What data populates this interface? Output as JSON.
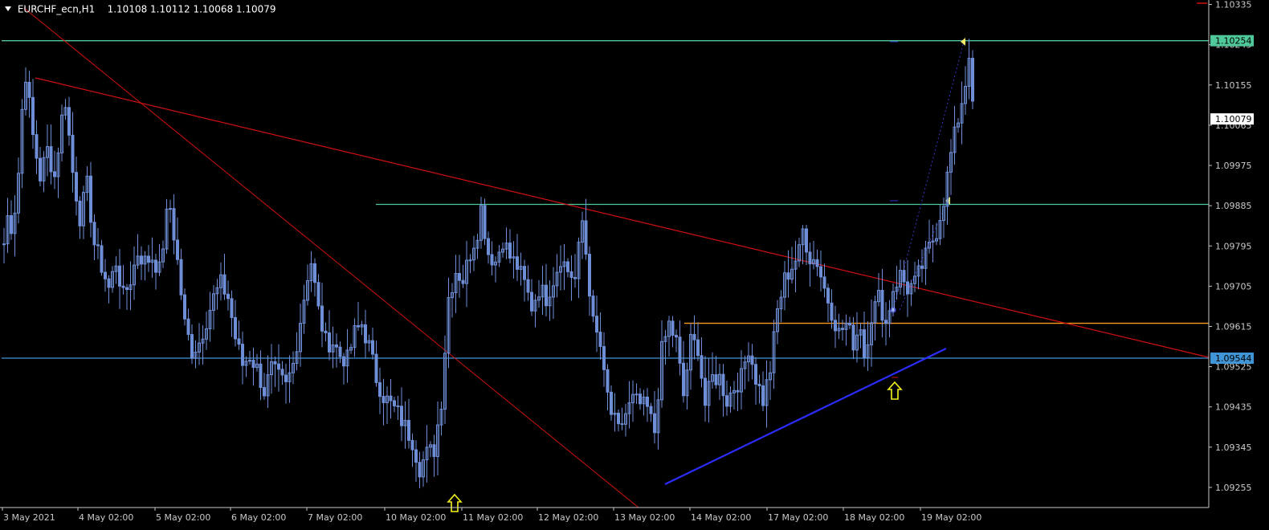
{
  "header": {
    "symbol": "EURCHF_ecn,H1",
    "ohlc": "1.10108 1.10112 1.10068 1.10079"
  },
  "colors": {
    "background": "#000000",
    "candle": "#6e8fd8",
    "axis": "#c8c8c8",
    "trend_red": "#d01010",
    "resistance_green": "#4fc99a",
    "support_orange": "#ff9a1a",
    "support_blue": "#3f95d6",
    "trend_blue": "#2c2cff",
    "arrow_yellow": "#f2f21e",
    "current_price_bg": "#ffffff"
  },
  "chart_data": {
    "type": "candlestick",
    "y_ticks": [
      "1.10335",
      "1.10245",
      "1.10155",
      "1.10065",
      "1.09975",
      "1.09885",
      "1.09795",
      "1.09705",
      "1.09615",
      "1.09525",
      "1.09435",
      "1.09345",
      "1.09255"
    ],
    "x_ticks": [
      "3 May 2021",
      "4 May 02:00",
      "5 May 02:00",
      "6 May 02:00",
      "7 May 02:00",
      "10 May 02:00",
      "11 May 02:00",
      "12 May 02:00",
      "13 May 02:00",
      "14 May 02:00",
      "17 May 02:00",
      "18 May 02:00",
      "19 May 02:00"
    ],
    "ylim": [
      1.0921,
      1.10345
    ],
    "price_labels": [
      {
        "value": "1.10254",
        "bg": "#4fc99a",
        "fg": "#000000"
      },
      {
        "value": "1.10079",
        "bg": "#ffffff",
        "fg": "#000000"
      },
      {
        "value": "1.09544",
        "bg": "#3f95d6",
        "fg": "#000000"
      }
    ],
    "horizontal_levels": [
      {
        "name": "level-1.10254",
        "price": 1.10254,
        "color": "#4fc99a"
      },
      {
        "name": "level-1.09888",
        "price": 1.09888,
        "color": "#4fc99a"
      },
      {
        "name": "level-1.09622",
        "price": 1.09622,
        "color": "#ff9a1a"
      },
      {
        "name": "level-1.09544",
        "price": 1.09544,
        "color": "#3f95d6"
      }
    ],
    "price_path": [
      [
        0,
        1.098
      ],
      [
        1,
        1.0986
      ],
      [
        2,
        1.0984
      ],
      [
        3,
        1.0988
      ],
      [
        4,
        1.0996
      ],
      [
        5,
        1.101
      ],
      [
        6,
        1.1018
      ],
      [
        8,
        1.1004
      ],
      [
        10,
        1.0995
      ],
      [
        12,
        1.1001
      ],
      [
        14,
        1.0995
      ],
      [
        16,
        1.1008
      ],
      [
        17,
        1.1012
      ],
      [
        19,
        1.0996
      ],
      [
        21,
        1.0986
      ],
      [
        23,
        1.0993
      ],
      [
        25,
        1.098
      ],
      [
        27,
        1.0975
      ],
      [
        29,
        1.097
      ],
      [
        31,
        1.0976
      ],
      [
        33,
        1.0968
      ],
      [
        35,
        1.0972
      ],
      [
        37,
        1.0978
      ],
      [
        39,
        1.0976
      ],
      [
        41,
        1.0977
      ],
      [
        43,
        1.0974
      ],
      [
        45,
        1.0986
      ],
      [
        46,
        1.0988
      ],
      [
        48,
        1.0976
      ],
      [
        50,
        1.0962
      ],
      [
        52,
        1.0956
      ],
      [
        54,
        1.0958
      ],
      [
        56,
        1.0963
      ],
      [
        58,
        1.0968
      ],
      [
        60,
        1.0971
      ],
      [
        62,
        1.0968
      ],
      [
        64,
        1.0959
      ],
      [
        66,
        1.0953
      ],
      [
        68,
        1.0955
      ],
      [
        70,
        1.0952
      ],
      [
        72,
        1.0947
      ],
      [
        74,
        1.0952
      ],
      [
        76,
        1.095
      ],
      [
        78,
        1.0948
      ],
      [
        80,
        1.0953
      ],
      [
        82,
        1.0963
      ],
      [
        84,
        1.0973
      ],
      [
        85,
        1.0976
      ],
      [
        87,
        1.0965
      ],
      [
        89,
        1.0958
      ],
      [
        91,
        1.0958
      ],
      [
        93,
        1.0955
      ],
      [
        95,
        1.0954
      ],
      [
        97,
        1.096
      ],
      [
        99,
        1.0962
      ],
      [
        101,
        1.0957
      ],
      [
        103,
        1.095
      ],
      [
        105,
        1.0946
      ],
      [
        107,
        1.0944
      ],
      [
        109,
        1.0942
      ],
      [
        111,
        1.0939
      ],
      [
        113,
        1.0936
      ],
      [
        115,
        1.093
      ],
      [
        117,
        1.0933
      ],
      [
        119,
        1.0934
      ],
      [
        121,
        1.0945
      ],
      [
        123,
        1.0968
      ],
      [
        125,
        1.0974
      ],
      [
        127,
        1.0972
      ],
      [
        129,
        1.0978
      ],
      [
        131,
        1.0983
      ],
      [
        132,
        1.0988
      ],
      [
        134,
        1.0978
      ],
      [
        136,
        1.0976
      ],
      [
        138,
        1.0981
      ],
      [
        140,
        1.0977
      ],
      [
        142,
        1.0975
      ],
      [
        144,
        1.0971
      ],
      [
        146,
        1.0966
      ],
      [
        148,
        1.097
      ],
      [
        150,
        1.0968
      ],
      [
        152,
        1.0972
      ],
      [
        154,
        1.0977
      ],
      [
        156,
        1.0974
      ],
      [
        158,
        1.0972
      ],
      [
        160,
        1.0985
      ],
      [
        161,
        1.0978
      ],
      [
        163,
        1.0962
      ],
      [
        165,
        1.0957
      ],
      [
        166,
        1.095
      ],
      [
        168,
        1.0942
      ],
      [
        170,
        1.0938
      ],
      [
        172,
        1.0942
      ],
      [
        174,
        1.0945
      ],
      [
        176,
        1.0944
      ],
      [
        178,
        1.0943
      ],
      [
        180,
        1.0938
      ],
      [
        182,
        1.0956
      ],
      [
        184,
        1.0962
      ],
      [
        186,
        1.0958
      ],
      [
        188,
        1.0946
      ],
      [
        190,
        1.0958
      ],
      [
        192,
        1.0957
      ],
      [
        194,
        1.0944
      ],
      [
        196,
        1.095
      ],
      [
        198,
        1.095
      ],
      [
        200,
        1.0945
      ],
      [
        202,
        1.0948
      ],
      [
        204,
        1.095
      ],
      [
        206,
        1.0957
      ],
      [
        208,
        1.095
      ],
      [
        210,
        1.0945
      ],
      [
        212,
        1.0952
      ],
      [
        214,
        1.0965
      ],
      [
        216,
        1.0972
      ],
      [
        218,
        1.0975
      ],
      [
        220,
        1.0978
      ],
      [
        221,
        1.0983
      ],
      [
        223,
        1.0977
      ],
      [
        225,
        1.0976
      ],
      [
        227,
        1.097
      ],
      [
        229,
        1.0965
      ],
      [
        231,
        1.096
      ],
      [
        233,
        1.0962
      ],
      [
        235,
        1.0958
      ],
      [
        237,
        1.0962
      ],
      [
        238,
        1.0955
      ],
      [
        240,
        1.0964
      ],
      [
        242,
        1.0968
      ],
      [
        244,
        1.0962
      ],
      [
        246,
        1.097
      ],
      [
        248,
        1.0973
      ],
      [
        250,
        1.097
      ],
      [
        252,
        1.0971
      ],
      [
        254,
        1.0975
      ],
      [
        256,
        1.0979
      ],
      [
        258,
        1.0983
      ],
      [
        260,
        1.099
      ],
      [
        262,
        1.1
      ],
      [
        264,
        1.1008
      ],
      [
        266,
        1.1016
      ],
      [
        267,
        1.1023
      ],
      [
        268,
        1.101
      ]
    ],
    "annotations": [
      {
        "name": "arrow-11may",
        "type": "up-arrow",
        "bar": 115,
        "price": 1.0926
      },
      {
        "name": "arrow-18may",
        "type": "up-arrow",
        "bar": 231,
        "price": 1.095
      }
    ]
  }
}
